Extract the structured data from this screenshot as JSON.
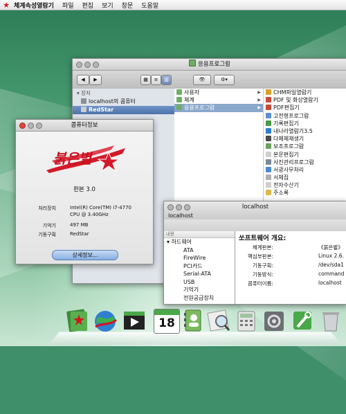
{
  "menubar": {
    "app_name": "체계속성열람기",
    "items": [
      "파일",
      "편집",
      "보기",
      "창문",
      "도움말"
    ]
  },
  "finder": {
    "title": "응용프로그람",
    "sidebar": {
      "header": "장치",
      "items": [
        "localhost의 콤퓨터",
        "RedStar"
      ]
    },
    "column1": [
      "사용자",
      "체계",
      "응용프로그람"
    ],
    "column2": [
      "CHM파일열람기",
      "PDF 및 화상열람기",
      "PDF편집기",
      "고전형프로그람",
      "기록편집기",
      "내나라열람기3.5",
      "다매체재생기",
      "보조프로그람",
      "본문편집기",
      "사진관리프로그람",
      "서광사무처리",
      "서체집",
      "전자수산기",
      "주소록"
    ]
  },
  "about": {
    "title": "콤퓨터정보",
    "version": "판본 3.0",
    "processor_label": "처리장치",
    "processor_value_1": "Intel(R) Core(TM) i7-4770",
    "processor_value_2": "CPU @ 3.40GHz",
    "memory_label": "기억기",
    "memory_value": "497 MB",
    "boot_label": "기동구획",
    "boot_value": "RedStar",
    "detail_button": "상세정보..."
  },
  "localhost": {
    "title": "localhost",
    "tree_header": "내용",
    "tree": [
      "하드웨어",
      "ATA",
      "FireWire",
      "PCI카드",
      "Serial-ATA",
      "USB",
      "기억기",
      "전원공급장치"
    ],
    "sw_title": "쏘프트웨어 개요:",
    "sw_rows": [
      {
        "k": "체계판본:",
        "v": "《붉은별》"
      },
      {
        "k": "핵심부판본:",
        "v": "Linux 2.6."
      },
      {
        "k": "기동구획:",
        "v": "/dev/sda1"
      },
      {
        "k": "기동방식:",
        "v": "command"
      },
      {
        "k": "콤퓨터이름:",
        "v": "localhost"
      }
    ]
  },
  "dock": {
    "calendar_day": "18"
  }
}
